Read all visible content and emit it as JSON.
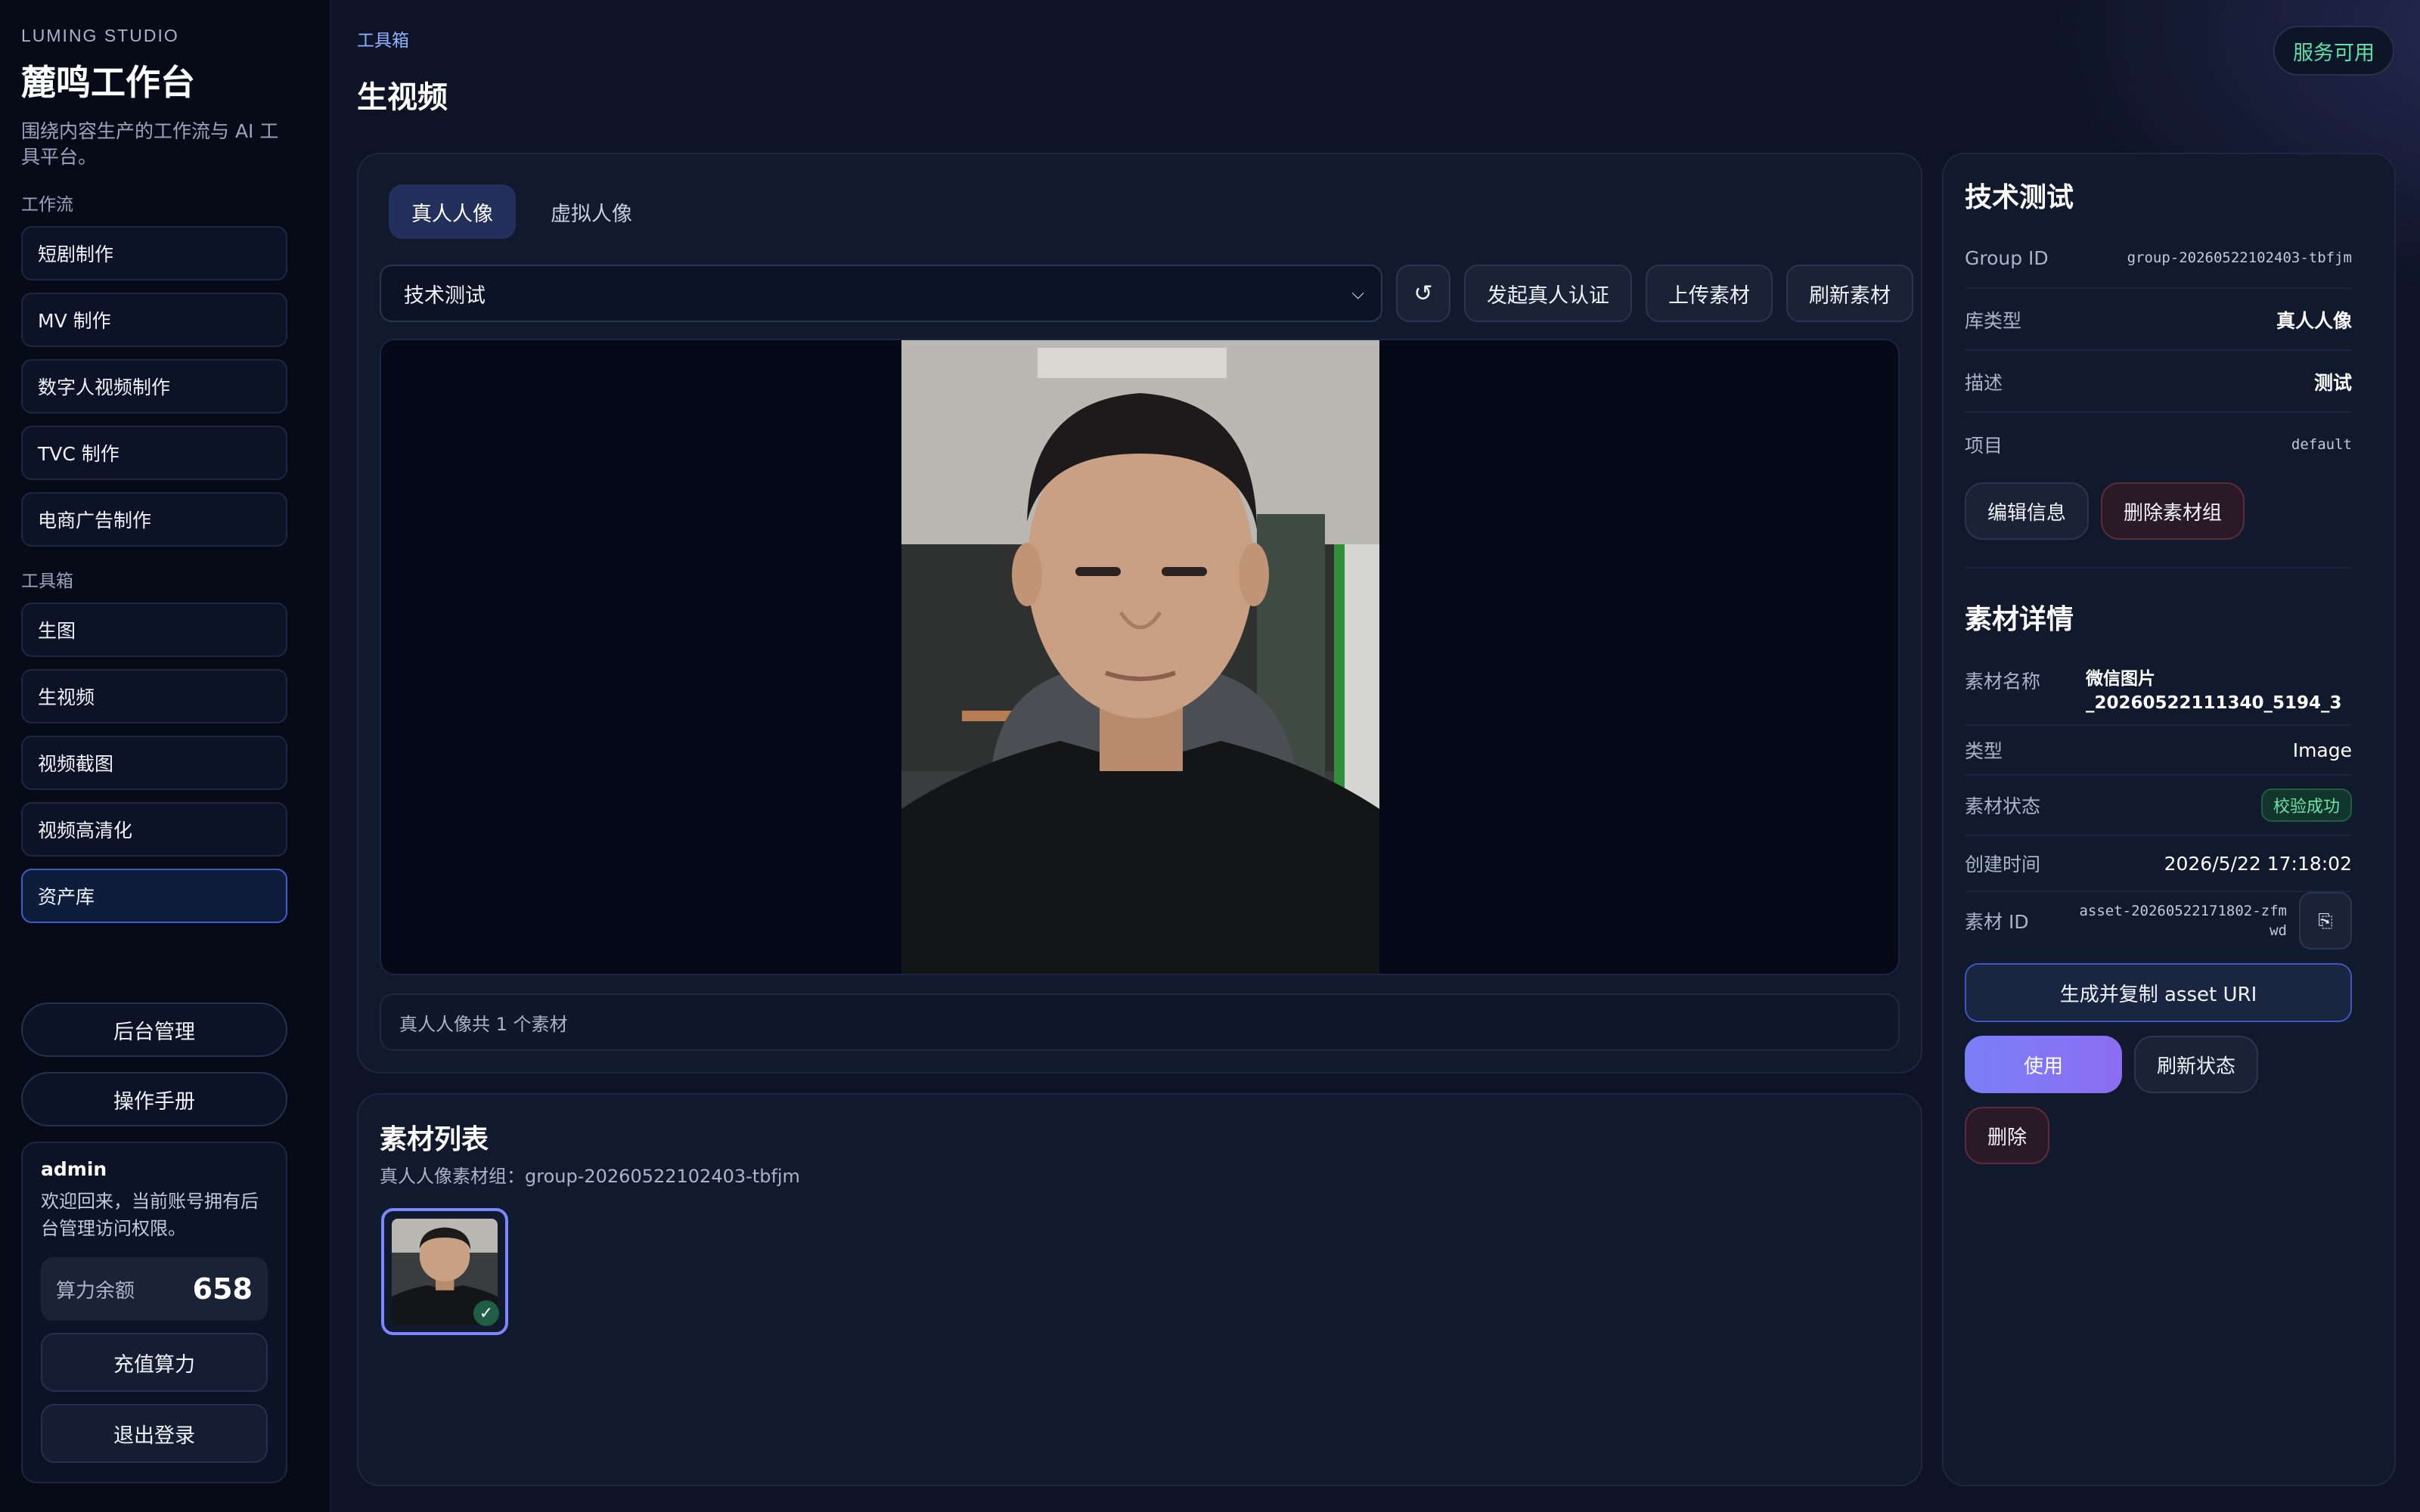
{
  "brand": {
    "subtitle": "LUMING STUDIO",
    "title": "麓鸣工作台",
    "description": "围绕内容生产的工作流与 AI 工具平台。"
  },
  "sidebar": {
    "workflow_label": "工作流",
    "workflow_items": [
      "短剧制作",
      "MV 制作",
      "数字人视频制作",
      "TVC 制作",
      "电商广告制作"
    ],
    "toolbox_label": "工具箱",
    "toolbox_items": [
      "生图",
      "生视频",
      "视频截图",
      "视频高清化",
      "资产库"
    ],
    "admin_button": "后台管理",
    "manual_button": "操作手册"
  },
  "user": {
    "name": "admin",
    "welcome": "欢迎回来，当前账号拥有后台管理访问权限。",
    "quota_label": "算力余额",
    "quota_value": "658",
    "recharge_button": "充值算力",
    "logout_button": "退出登录"
  },
  "header": {
    "breadcrumb": "工具箱",
    "title": "生视频",
    "status": "服务可用"
  },
  "preview": {
    "tabs": [
      "真人人像",
      "虚拟人像"
    ],
    "selected_group": "技术测试",
    "refresh_icon": "↺",
    "buttons": {
      "verify": "发起真人认证",
      "upload": "上传素材",
      "refresh": "刷新素材"
    },
    "count_text": "真人人像共 1 个素材"
  },
  "asset_list": {
    "title": "素材列表",
    "subtitle": "真人人像素材组：group-20260522102403-tbfjm",
    "check_mark": "✓"
  },
  "group_info": {
    "title": "技术测试",
    "rows": [
      {
        "label": "Group ID",
        "value": "group-20260522102403-tbfjm"
      },
      {
        "label": "库类型",
        "value": "真人人像"
      },
      {
        "label": "描述",
        "value": "测试"
      },
      {
        "label": "项目",
        "value": "default"
      }
    ],
    "edit_button": "编辑信息",
    "delete_group_button": "删除素材组"
  },
  "asset_detail": {
    "title": "素材详情",
    "name_label": "素材名称",
    "name_line1": "微信图片",
    "name_line2": "_20260522111340_5194_3",
    "type_label": "类型",
    "type_value": "Image",
    "status_label": "素材状态",
    "status_value": "校验成功",
    "created_label": "创建时间",
    "created_value": "2026/5/22 17:18:02",
    "id_label": "素材 ID",
    "id_line1": "asset-20260522171802-zfm",
    "id_line2": "wd",
    "copy_icon": "⎘",
    "uri_button": "生成并复制 asset URI",
    "use_button": "使用",
    "refresh_status_button": "刷新状态",
    "delete_button": "删除"
  },
  "colors": {
    "accent": "#7b7ff7",
    "success": "#5fe0a8",
    "background": "#0e1426"
  }
}
